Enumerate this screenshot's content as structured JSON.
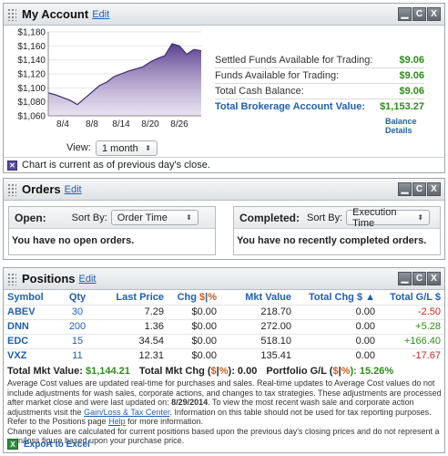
{
  "account": {
    "title": "My Account",
    "edit_label": "Edit",
    "funds": [
      {
        "label": "Settled Funds Available for Trading:",
        "value": "$9.06"
      },
      {
        "label": "Funds Available for Trading:",
        "value": "$9.06"
      },
      {
        "label": "Total Cash Balance:",
        "value": "$9.06"
      }
    ],
    "total_label": "Total Brokerage Account Value:",
    "total_value": "$1,153.27",
    "balance_details_label": "Balance Details",
    "view_label": "View:",
    "view_option": "1 month",
    "note": "Chart is current as of previous day's close."
  },
  "window_buttons": {
    "minimize": "▁",
    "refresh": "C",
    "close": "X"
  },
  "chart_data": {
    "type": "area",
    "x_ticks": [
      "8/4",
      "8/8",
      "8/14",
      "8/20",
      "8/26"
    ],
    "y_ticks": [
      "$1,180",
      "$1,160",
      "$1,140",
      "$1,120",
      "$1,100",
      "$1,080",
      "$1,060"
    ],
    "ylim": [
      1060,
      1180
    ],
    "color": "#5b3f8e",
    "x": [
      "7/31",
      "8/1",
      "8/4",
      "8/5",
      "8/6",
      "8/7",
      "8/8",
      "8/11",
      "8/12",
      "8/13",
      "8/14",
      "8/15",
      "8/18",
      "8/19",
      "8/20",
      "8/21",
      "8/22",
      "8/25",
      "8/26",
      "8/27",
      "8/28",
      "8/29"
    ],
    "values": [
      1093,
      1090,
      1086,
      1082,
      1076,
      1085,
      1094,
      1103,
      1108,
      1116,
      1120,
      1124,
      1127,
      1130,
      1137,
      1142,
      1146,
      1163,
      1160,
      1148,
      1155,
      1153
    ]
  },
  "orders": {
    "title": "Orders",
    "edit_label": "Edit",
    "open_label": "Open:",
    "sort_by_label": "Sort By:",
    "open_sort": "Order Time",
    "open_msg": "You have no open orders.",
    "completed_label": "Completed:",
    "completed_sort": "Execution Time",
    "completed_msg": "You have no recently completed orders."
  },
  "positions": {
    "title": "Positions",
    "edit_label": "Edit",
    "headers": [
      "Symbol",
      "Qty",
      "Last Price",
      "Chg",
      "$",
      "|",
      "%",
      "Mkt Value",
      "Total Chg $ ▲",
      "Total G/L $"
    ],
    "rows": [
      {
        "symbol": "ABEV",
        "qty": "30",
        "last": "7.29",
        "chg": "$0.00",
        "mkt": "218.70",
        "tchg": "0.00",
        "gl": "-2.50"
      },
      {
        "symbol": "DNN",
        "qty": "200",
        "last": "1.36",
        "chg": "$0.00",
        "mkt": "272.00",
        "tchg": "0.00",
        "gl": "+5.28"
      },
      {
        "symbol": "EDC",
        "qty": "15",
        "last": "34.54",
        "chg": "$0.00",
        "mkt": "518.10",
        "tchg": "0.00",
        "gl": "+166.40"
      },
      {
        "symbol": "VXZ",
        "qty": "11",
        "last": "12.31",
        "chg": "$0.00",
        "mkt": "135.41",
        "tchg": "0.00",
        "gl": "-17.67"
      }
    ],
    "total_mkt_label": "Total Mkt Value:",
    "total_mkt_value": "$1,144.21",
    "total_chg_label": "Total Mkt Chg (",
    "total_chg_mid": "|",
    "total_chg_end": "): 0.00",
    "portfolio_label": "Portfolio G/L (",
    "portfolio_end": "): 15.26%",
    "dollar": "$",
    "percent": "%",
    "disclaimer_1": "Average Cost values are updated real-time for purchases and sales. Real-time updates to Average Cost values do not include adjustments for wash sales, corporate actions, and changes to tax strategies. These adjustments are processed after market close and were last updated on:",
    "disclaimer_date": "8/29/2014",
    "disclaimer_2": ". To view the most recent wash sale and corporate action adjustments visit the",
    "disclaimer_link": "Gain/Loss & Tax Center",
    "disclaimer_3": ". Information on this table should not be used for tax reporting purposes. Refer to the Positions page",
    "disclaimer_help": "Help",
    "disclaimer_4": "for more information.",
    "disclaimer_5": "Change values are calculated for current positions based upon the previous day's closing prices and do not represent a gain/loss figure based upon your purchase price.",
    "export_label": "Export to Excel"
  }
}
